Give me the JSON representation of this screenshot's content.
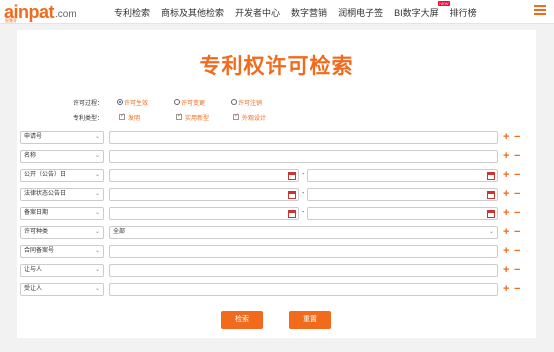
{
  "header": {
    "logo_text": "ainpat",
    "logo_domain": ".com",
    "logo_sub": "智慧芽",
    "nav": [
      "专利检索",
      "商标及其他检索",
      "开发者中心",
      "数字营销",
      "润桐电子签",
      "BI数字大屏",
      "排行榜"
    ],
    "new_badge": "NEW",
    "accent": "#f26a1b"
  },
  "page": {
    "title": "专利权许可检索"
  },
  "options": {
    "license_process_label": "许可过程：",
    "license_process": [
      "许可生效",
      "许可变更",
      "许可注销"
    ],
    "patent_type_label": "专利类型：",
    "patent_type": [
      "发明",
      "实用新型",
      "外观设计"
    ]
  },
  "fields": [
    {
      "label": "申请号"
    },
    {
      "label": "名称"
    },
    {
      "label": "公开（公告）日"
    },
    {
      "label": "法律状态公告日"
    },
    {
      "label": "备案日期"
    },
    {
      "label": "许可种类",
      "value": "全部"
    },
    {
      "label": "合同备案号"
    },
    {
      "label": "让与人"
    },
    {
      "label": "受让人"
    }
  ],
  "buttons": {
    "search": "检索",
    "reset": "重置"
  }
}
